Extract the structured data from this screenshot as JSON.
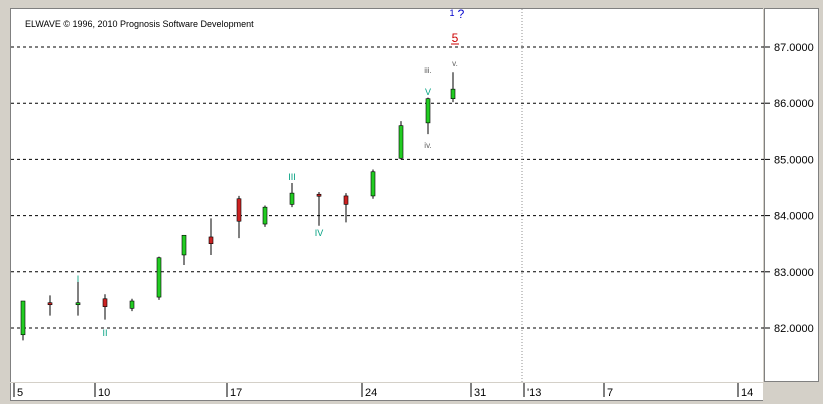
{
  "copyright": "ELWAVE © 1996, 2010 Prognosis Software Development",
  "chart_data": {
    "type": "candlestick",
    "price_axis": {
      "ticks": [
        "82.0000",
        "83.0000",
        "84.0000",
        "85.0000",
        "86.0000",
        "87.0000"
      ],
      "ylim": [
        81.75,
        88.5
      ]
    },
    "date_axis": {
      "labels": [
        "5",
        "10",
        "17",
        "24",
        "31",
        "'13",
        "7",
        "14"
      ]
    },
    "candles": [
      {
        "d": "Dec 5",
        "o": 81.88,
        "h": 82.48,
        "l": 81.78,
        "c": 82.48,
        "color": "green"
      },
      {
        "d": "Dec 6",
        "o": 82.45,
        "h": 82.58,
        "l": 82.22,
        "c": 82.42,
        "color": "red"
      },
      {
        "d": "Dec 7",
        "o": 82.42,
        "h": 82.82,
        "l": 82.22,
        "c": 82.45,
        "color": "green"
      },
      {
        "d": "Dec 10",
        "o": 82.52,
        "h": 82.6,
        "l": 82.15,
        "c": 82.38,
        "color": "red"
      },
      {
        "d": "Dec 11",
        "o": 82.35,
        "h": 82.52,
        "l": 82.3,
        "c": 82.48,
        "color": "green"
      },
      {
        "d": "Dec 12",
        "o": 82.55,
        "h": 83.27,
        "l": 82.5,
        "c": 83.25,
        "color": "green"
      },
      {
        "d": "Dec 13",
        "o": 83.3,
        "h": 83.65,
        "l": 83.12,
        "c": 83.65,
        "color": "green"
      },
      {
        "d": "Dec 14",
        "o": 83.62,
        "h": 83.95,
        "l": 83.3,
        "c": 83.5,
        "color": "red"
      },
      {
        "d": "Dec 17",
        "o": 84.3,
        "h": 84.35,
        "l": 83.6,
        "c": 83.9,
        "color": "red"
      },
      {
        "d": "Dec 18",
        "o": 83.85,
        "h": 84.18,
        "l": 83.8,
        "c": 84.15,
        "color": "green"
      },
      {
        "d": "Dec 19",
        "o": 84.2,
        "h": 84.58,
        "l": 84.15,
        "c": 84.4,
        "color": "green"
      },
      {
        "d": "Dec 20",
        "o": 84.38,
        "h": 84.42,
        "l": 83.82,
        "c": 84.38,
        "color": "red"
      },
      {
        "d": "Dec 21",
        "o": 84.35,
        "h": 84.4,
        "l": 83.88,
        "c": 84.2,
        "color": "red"
      },
      {
        "d": "Dec 24",
        "o": 84.35,
        "h": 84.82,
        "l": 84.3,
        "c": 84.78,
        "color": "green"
      },
      {
        "d": "Dec 26",
        "o": 85.02,
        "h": 85.68,
        "l": 85.0,
        "c": 85.6,
        "color": "green"
      },
      {
        "d": "Dec 27",
        "o": 85.65,
        "h": 86.1,
        "l": 85.45,
        "c": 86.08,
        "color": "green"
      },
      {
        "d": "Dec 28",
        "o": 86.08,
        "h": 86.55,
        "l": 86.02,
        "c": 86.25,
        "color": "green"
      }
    ],
    "wave_labels": [
      {
        "text": "I",
        "color": "#00a080"
      },
      {
        "text": "II",
        "color": "#00a080"
      },
      {
        "text": "III",
        "color": "#00a080"
      },
      {
        "text": "IV",
        "color": "#00a080"
      },
      {
        "text": "V",
        "color": "#00a080"
      },
      {
        "text": "iii.",
        "color": "#606060"
      },
      {
        "text": "iv.",
        "color": "#606060"
      },
      {
        "text": "v.",
        "color": "#606060"
      },
      {
        "text": "5",
        "color": "#cc0000"
      },
      {
        "text": "1",
        "color": "#0000cc"
      },
      {
        "text": "?",
        "color": "#0000cc"
      }
    ],
    "grid": "horizontal dashed",
    "colors": {
      "up": "#22cc22",
      "down": "#cc2222",
      "wick": "#000000",
      "grid": "#000000"
    }
  }
}
